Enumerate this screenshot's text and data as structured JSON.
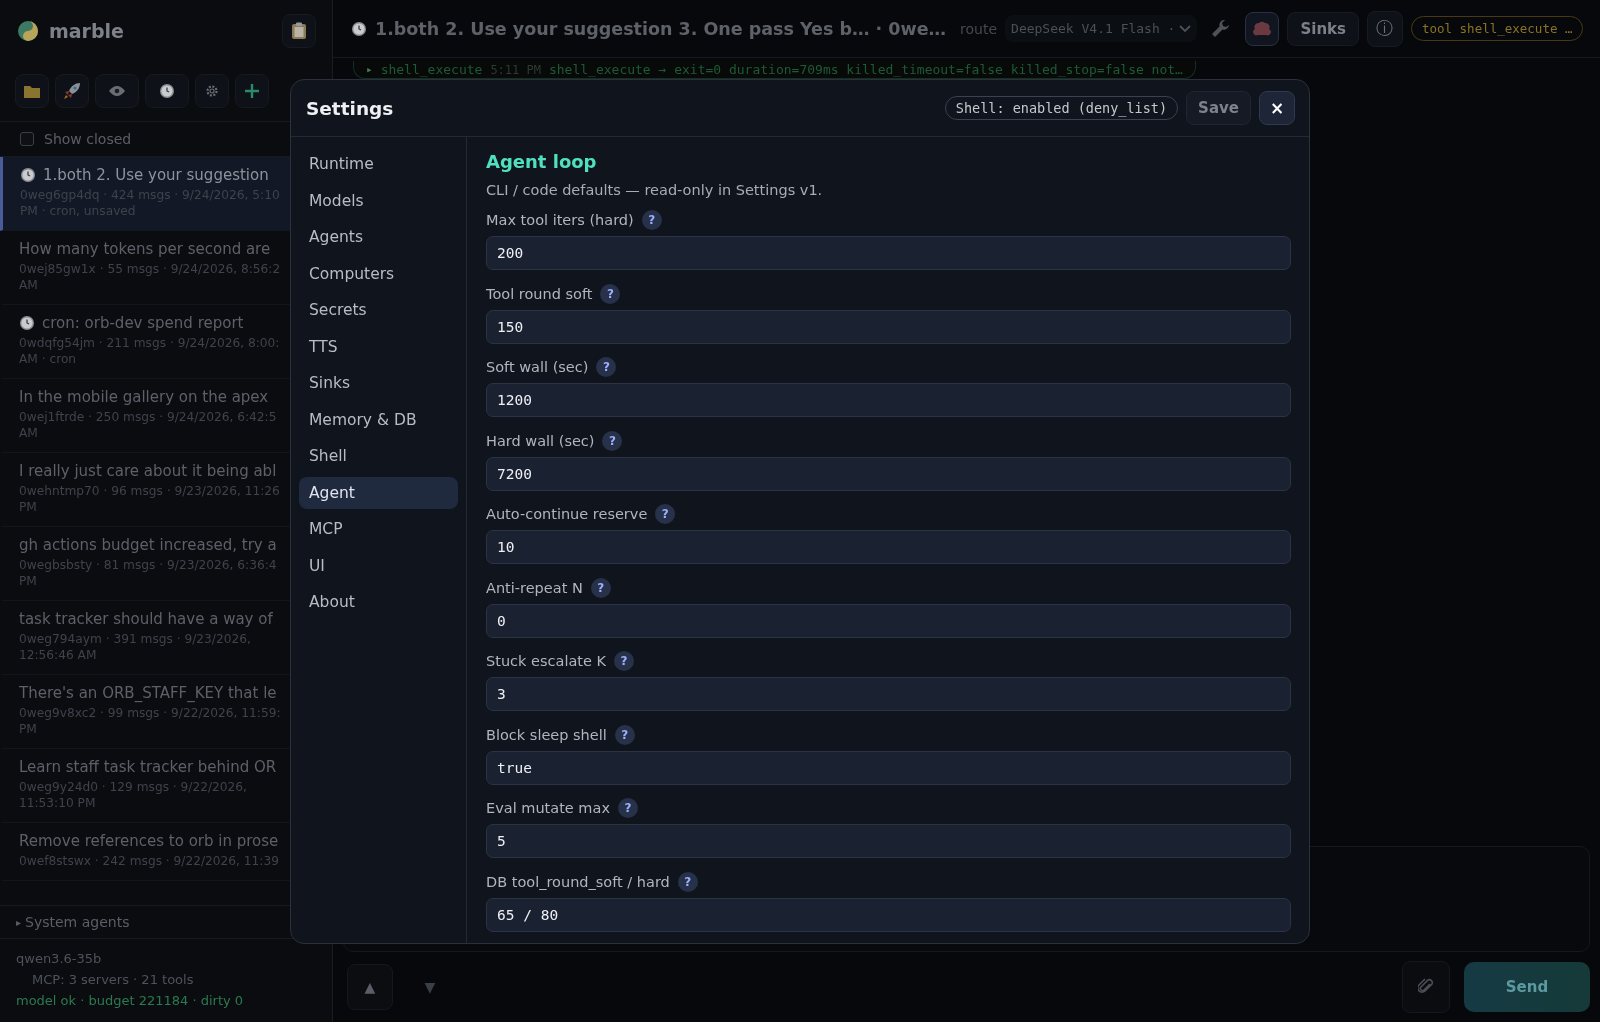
{
  "app": {
    "name": "marble"
  },
  "sidebar": {
    "show_closed": {
      "label": "Show closed",
      "checked": false
    },
    "conversations": [
      {
        "title": "1.both 2. Use your suggestion",
        "meta_lines": [
          "0weg6gp4dq · 424 msgs · 9/24/2026, 5:10",
          "PM · cron, unsaved"
        ],
        "scheduled": true,
        "selected": true
      },
      {
        "title": "How many tokens per second are",
        "meta_lines": [
          "0wej85gw1x · 55 msgs · 9/24/2026, 8:56:2",
          "AM"
        ],
        "scheduled": false,
        "selected": false
      },
      {
        "title": "cron: orb-dev spend report",
        "meta_lines": [
          "0wdqfg54jm · 211 msgs · 9/24/2026, 8:00:",
          "AM · cron"
        ],
        "scheduled": true,
        "selected": false
      },
      {
        "title": "In the mobile gallery on the apex",
        "meta_lines": [
          "0wej1ftrde · 250 msgs · 9/24/2026, 6:42:5",
          "AM"
        ],
        "scheduled": false,
        "selected": false
      },
      {
        "title": "I really just care about it being abl",
        "meta_lines": [
          "0wehntmp70 · 96 msgs · 9/23/2026, 11:26",
          "PM"
        ],
        "scheduled": false,
        "selected": false
      },
      {
        "title": "gh actions budget increased, try a",
        "meta_lines": [
          "0wegbsbsty · 81 msgs · 9/23/2026, 6:36:4",
          "PM"
        ],
        "scheduled": false,
        "selected": false
      },
      {
        "title": "task tracker should have a way of",
        "meta_lines": [
          "0weg794aym · 391 msgs · 9/23/2026,",
          "12:56:46 AM"
        ],
        "scheduled": false,
        "selected": false
      },
      {
        "title": "There's an ORB_STAFF_KEY that le",
        "meta_lines": [
          "0weg9v8xc2 · 99 msgs · 9/22/2026, 11:59:",
          "PM"
        ],
        "scheduled": false,
        "selected": false
      },
      {
        "title": "Learn staff task tracker behind OR",
        "meta_lines": [
          "0weg9y24d0 · 129 msgs · 9/22/2026,",
          "11:53:10 PM"
        ],
        "scheduled": false,
        "selected": false
      },
      {
        "title": "Remove references to orb in prose",
        "meta_lines": [
          "0wef8stswx · 242 msgs · 9/22/2026, 11:39"
        ],
        "scheduled": false,
        "selected": false
      }
    ],
    "system_agents": {
      "marker": "▸",
      "label": "System agents"
    },
    "footer": {
      "model": "qwen3.6-35b",
      "mcp": "MCP: 3 servers · 21 tools",
      "status": "model ok · budget 221184 · dirty 0"
    }
  },
  "topbar": {
    "title": "1.both 2. Use your suggestion 3. One pass Yes b… · 0we…",
    "route": "route",
    "model": "DeepSeek V4.1 Flash ·",
    "sinks": "Sinks",
    "info": "ⓘ",
    "tool_badge": "tool shell_execute …"
  },
  "log": {
    "marker": "▸",
    "tool": "shell_execute",
    "time": "5:11 PM",
    "text": "shell_execute → exit=0 duration=709ms killed_timeout=false killed_stop=false not…"
  },
  "composer": {
    "up": "▲",
    "down": "▼",
    "send": "Send"
  },
  "settings": {
    "title": "Settings",
    "shell_badge": "Shell: enabled (deny_list)",
    "save": "Save",
    "close": "×",
    "nav": [
      {
        "label": "Runtime",
        "selected": false
      },
      {
        "label": "Models",
        "selected": false
      },
      {
        "label": "Agents",
        "selected": false
      },
      {
        "label": "Computers",
        "selected": false
      },
      {
        "label": "Secrets",
        "selected": false
      },
      {
        "label": "TTS",
        "selected": false
      },
      {
        "label": "Sinks",
        "selected": false
      },
      {
        "label": "Memory & DB",
        "selected": false
      },
      {
        "label": "Shell",
        "selected": false
      },
      {
        "label": "Agent",
        "selected": true
      },
      {
        "label": "MCP",
        "selected": false
      },
      {
        "label": "UI",
        "selected": false
      },
      {
        "label": "About",
        "selected": false
      }
    ],
    "section": {
      "heading": "Agent loop",
      "description": "CLI / code defaults — read-only in Settings v1.",
      "fields": [
        {
          "label": "Max tool iters (hard)",
          "help": "?",
          "value": "200"
        },
        {
          "label": "Tool round soft",
          "help": "?",
          "value": "150"
        },
        {
          "label": "Soft wall (sec)",
          "help": "?",
          "value": "1200"
        },
        {
          "label": "Hard wall (sec)",
          "help": "?",
          "value": "7200"
        },
        {
          "label": "Auto-continue reserve",
          "help": "?",
          "value": "10"
        },
        {
          "label": "Anti-repeat N",
          "help": "?",
          "value": "0"
        },
        {
          "label": "Stuck escalate K",
          "help": "?",
          "value": "3"
        },
        {
          "label": "Block sleep shell",
          "help": "?",
          "value": "true"
        },
        {
          "label": "Eval mutate max",
          "help": "?",
          "value": "5"
        },
        {
          "label": "DB tool_round_soft / hard",
          "help": "?",
          "value": "65 / 80"
        }
      ]
    }
  }
}
